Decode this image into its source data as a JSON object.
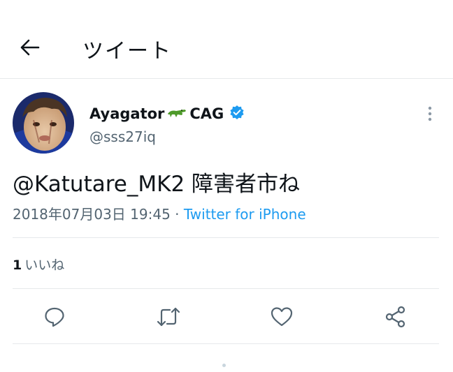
{
  "header": {
    "title": "ツイート",
    "back_icon": "arrow-left-icon"
  },
  "author": {
    "name_part1": "Ayagator",
    "name_part2": "CAG",
    "name_emoji": "crocodile-icon",
    "handle": "@sss27iq",
    "verified": true
  },
  "tweet": {
    "text": "@Katutare_MK2 障害者市ね",
    "timestamp": "2018年07月03日 19:45",
    "separator": "·",
    "source": "Twitter for iPhone"
  },
  "stats": {
    "likes_count": "1",
    "likes_label": "いいね"
  },
  "actions": [
    "reply-icon",
    "retweet-icon",
    "like-icon",
    "share-icon"
  ],
  "colors": {
    "accent": "#1d9bf0",
    "secondary_text": "#536471",
    "border": "#e6e9eb"
  }
}
